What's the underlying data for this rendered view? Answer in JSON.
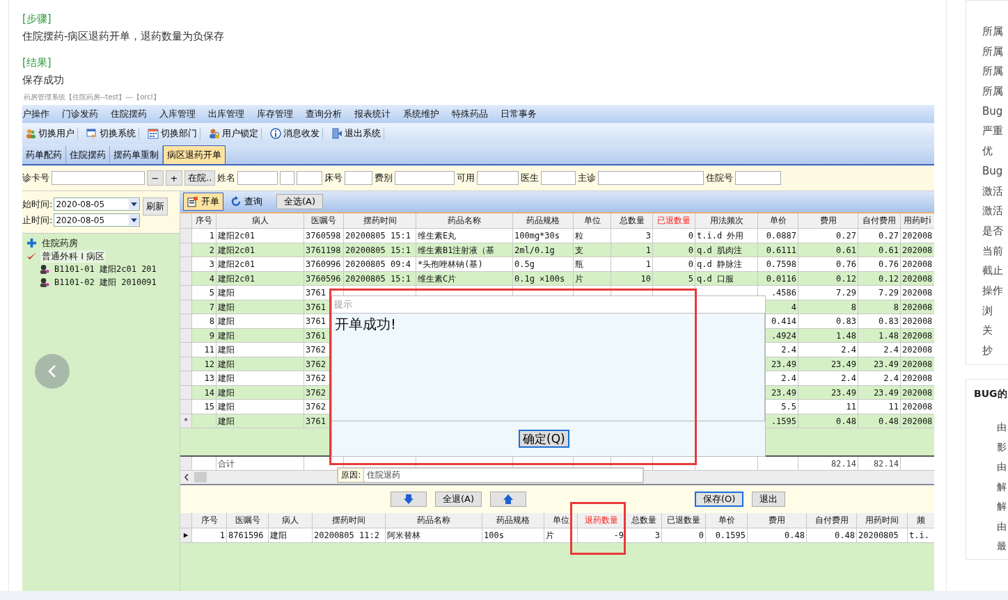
{
  "instructions": {
    "steps_label": "[步骤]",
    "steps": "住院摆药-病区退药开单，退药数量为负保存",
    "result_label": "[结果]",
    "result": "保存成功"
  },
  "app": {
    "title": "药房管理系统【住院药房--test】---【orcl】",
    "menu": [
      "户操作",
      "门诊发药",
      "住院摆药",
      "入库管理",
      "出库管理",
      "库存管理",
      "查询分析",
      "报表统计",
      "系统维护",
      "特殊药品",
      "日常事务"
    ],
    "toolbar": [
      {
        "label": "切换用户",
        "kind": "user"
      },
      {
        "label": "切换系统",
        "kind": "system"
      },
      {
        "label": "切换部门",
        "kind": "department"
      },
      {
        "label": "用户锁定",
        "kind": "lock"
      },
      {
        "label": "消息收发",
        "kind": "info"
      },
      {
        "label": "退出系统",
        "kind": "exit"
      }
    ],
    "tabs": [
      {
        "label": "药单配药",
        "selected": false
      },
      {
        "label": "住院摆药",
        "selected": false
      },
      {
        "label": "摆药单重制",
        "selected": false
      },
      {
        "label": "病区退药开单",
        "selected": true
      }
    ],
    "filter": [
      {
        "kind": "label",
        "text": "诊卡号"
      },
      {
        "kind": "field"
      },
      {
        "kind": "button",
        "text": "−"
      },
      {
        "kind": "button",
        "text": "+"
      },
      {
        "kind": "button",
        "text": "在院.."
      },
      {
        "kind": "label",
        "text": "姓名"
      },
      {
        "kind": "field"
      },
      {
        "kind": "field"
      },
      {
        "kind": "field"
      },
      {
        "kind": "label",
        "text": "床号"
      },
      {
        "kind": "field"
      },
      {
        "kind": "label",
        "text": "费别"
      },
      {
        "kind": "field"
      },
      {
        "kind": "label",
        "text": "可用"
      },
      {
        "kind": "field"
      },
      {
        "kind": "label",
        "text": "医生"
      },
      {
        "kind": "field"
      },
      {
        "kind": "label",
        "text": "主诊"
      },
      {
        "kind": "field"
      },
      {
        "kind": "label",
        "text": "住院号"
      },
      {
        "kind": "field"
      }
    ],
    "date_filters": [
      {
        "label": "始时间:",
        "value": "2020-08-05"
      },
      {
        "label": "止时间:",
        "value": "2020-08-05"
      }
    ],
    "refresh_button": "刷新",
    "tree": [
      {
        "label": "住院药房",
        "kind": "pharmacy",
        "selected": false
      },
      {
        "label": "普通外科 I 病区",
        "kind": "ward",
        "selected": true,
        "children": [
          {
            "label": "B1101-01 建阳2c01 201",
            "kind": "bed",
            "selected": false
          },
          {
            "label": "B1101-02 建阳 2010091",
            "kind": "bed",
            "selected": false
          }
        ]
      }
    ],
    "actions": [
      {
        "label": "开单",
        "kind": "new",
        "selected": true
      },
      {
        "label": "查询",
        "kind": "query",
        "selected": false
      }
    ],
    "select_all": "全选(A)",
    "upper_grid": {
      "columns": [
        {
          "label": "序号",
          "highlight": false
        },
        {
          "label": "病人",
          "highlight": false
        },
        {
          "label": "医嘱号",
          "highlight": false
        },
        {
          "label": "摆药时间",
          "highlight": false
        },
        {
          "label": "药品名称",
          "highlight": false
        },
        {
          "label": "药品规格",
          "highlight": false
        },
        {
          "label": "单位",
          "highlight": false
        },
        {
          "label": "总数量",
          "highlight": false
        },
        {
          "label": "已退数量",
          "highlight": true
        },
        {
          "label": "用法频次",
          "highlight": false
        },
        {
          "label": "单价",
          "highlight": false
        },
        {
          "label": "费用",
          "highlight": false
        },
        {
          "label": "自付费用",
          "highlight": false
        },
        {
          "label": "用药时i",
          "highlight": false
        }
      ],
      "rows": [
        {
          "seq": "1",
          "patient": "建阳2c01",
          "order": "3760598",
          "time": "20200805 15:1",
          "drug": "维生素E丸",
          "spec": "100mg*30s",
          "unit": "粒",
          "total": "3",
          "returned": "0",
          "usage": "t.i.d 外用",
          "price": "0.0887",
          "fee": "0.27",
          "self_pay": "0.27",
          "use_time": "202008"
        },
        {
          "seq": "2",
          "patient": "建阳2c01",
          "order": "3761198",
          "time": "20200805 15:1",
          "drug": "维生素B1注射液（基",
          "spec": "2ml/0.1g",
          "unit": "支",
          "total": "1",
          "returned": "0",
          "usage": "q.d 肌肉注",
          "price": "0.6111",
          "fee": "0.61",
          "self_pay": "0.61",
          "use_time": "202008"
        },
        {
          "seq": "3",
          "patient": "建阳2c01",
          "order": "3760996",
          "time": "20200805 09:4",
          "drug": "*头孢唑林钠(基)",
          "spec": "0.5g",
          "unit": "瓶",
          "total": "1",
          "returned": "0",
          "usage": "q.d 静脉注",
          "price": "0.7598",
          "fee": "0.76",
          "self_pay": "0.76",
          "use_time": "202008"
        },
        {
          "seq": "4",
          "patient": "建阳2c01",
          "order": "3760596",
          "time": "20200805 15:1",
          "drug": "维生素C片",
          "spec": "0.1g ×100s",
          "unit": "片",
          "total": "10",
          "returned": "5",
          "usage": "q.d 口服",
          "price": "0.0116",
          "fee": "0.12",
          "self_pay": "0.12",
          "use_time": "202008"
        },
        {
          "seq": "5",
          "patient": "建阳",
          "order": "3761",
          "price": ".4586",
          "fee": "7.29",
          "self_pay": "7.29",
          "use_time": "202008"
        },
        {
          "seq": "7",
          "patient": "建阳",
          "order": "3761",
          "price": "4",
          "fee": "8",
          "self_pay": "8",
          "use_time": "202008"
        },
        {
          "seq": "8",
          "patient": "建阳",
          "order": "3761",
          "price": "0.414",
          "fee": "0.83",
          "self_pay": "0.83",
          "use_time": "202008"
        },
        {
          "seq": "9",
          "patient": "建阳",
          "order": "3761",
          "price": ".4924",
          "fee": "1.48",
          "self_pay": "1.48",
          "use_time": "202008"
        },
        {
          "seq": "11",
          "patient": "建阳",
          "order": "3762",
          "price": "2.4",
          "fee": "2.4",
          "self_pay": "2.4",
          "use_time": "202008"
        },
        {
          "seq": "12",
          "patient": "建阳",
          "order": "3762",
          "price": "23.49",
          "fee": "23.49",
          "self_pay": "23.49",
          "use_time": "202008"
        },
        {
          "seq": "13",
          "patient": "建阳",
          "order": "3762",
          "price": "2.4",
          "fee": "2.4",
          "self_pay": "2.4",
          "use_time": "202008"
        },
        {
          "seq": "14",
          "patient": "建阳",
          "order": "3762",
          "price": "23.49",
          "fee": "23.49",
          "self_pay": "23.49",
          "use_time": "202008"
        },
        {
          "seq": "15",
          "patient": "建阳",
          "order": "3762",
          "price": "5.5",
          "fee": "11",
          "self_pay": "11",
          "use_time": "202008"
        },
        {
          "marker": "*",
          "patient": "建阳",
          "order": "3761",
          "price": ".1595",
          "fee": "0.48",
          "self_pay": "0.48",
          "use_time": "202008"
        }
      ],
      "total": {
        "patient": "合计",
        "fee": "82.14",
        "self_pay": "82.14"
      }
    },
    "dialog": {
      "title": "提示",
      "message": "开单成功!",
      "button": "确定(Q)"
    },
    "reason": {
      "label": "原因:",
      "value": "住院退药"
    },
    "bottom_buttons": [
      {
        "kind": "down"
      },
      {
        "kind": "text",
        "label": "全退(A)",
        "focused": false
      },
      {
        "kind": "up"
      },
      {
        "kind": "text",
        "label": "保存(O)",
        "focused": true
      },
      {
        "kind": "text",
        "label": "退出",
        "focused": false
      }
    ],
    "lower_grid": {
      "columns": [
        {
          "label": "序号",
          "highlight": false
        },
        {
          "label": "医嘱号",
          "highlight": false
        },
        {
          "label": "病人",
          "highlight": false
        },
        {
          "label": "摆药时间",
          "highlight": false
        },
        {
          "label": "药品名称",
          "highlight": false
        },
        {
          "label": "药品规格",
          "highlight": false
        },
        {
          "label": "单位",
          "highlight": false
        },
        {
          "label": "退药数量",
          "highlight": true
        },
        {
          "label": "总数量",
          "highlight": false
        },
        {
          "label": "已退数量",
          "highlight": false
        },
        {
          "label": "单价",
          "highlight": false
        },
        {
          "label": "费用",
          "highlight": false
        },
        {
          "label": "自付费用",
          "highlight": false
        },
        {
          "label": "用药时间",
          "highlight": false
        },
        {
          "label": "频",
          "highlight": false
        }
      ],
      "rows": [
        {
          "marker": "▶",
          "seq": "1",
          "order": "8761596",
          "patient": "建阳",
          "time": "20200805 11:2",
          "drug": "阿米替林",
          "spec": "100s",
          "unit": "片",
          "return_qty": "-9",
          "total": "3",
          "returned": "0",
          "price": "0.1595",
          "fee": "0.48",
          "self_pay": "0.48",
          "use_time": "20200805",
          "freq": "t.i."
        }
      ]
    }
  },
  "sidebar": {
    "fields": [
      "所属",
      "所属",
      "所属",
      "所属",
      "Bug",
      "严重",
      "优",
      "Bug",
      "激活",
      "激活",
      "是否",
      "当前",
      "截止",
      "操作",
      "浏",
      "关",
      "抄"
    ],
    "bug_card": {
      "title": "BUG的",
      "items": [
        "由",
        "影",
        "由",
        "解",
        "解",
        "由",
        "最"
      ]
    }
  }
}
